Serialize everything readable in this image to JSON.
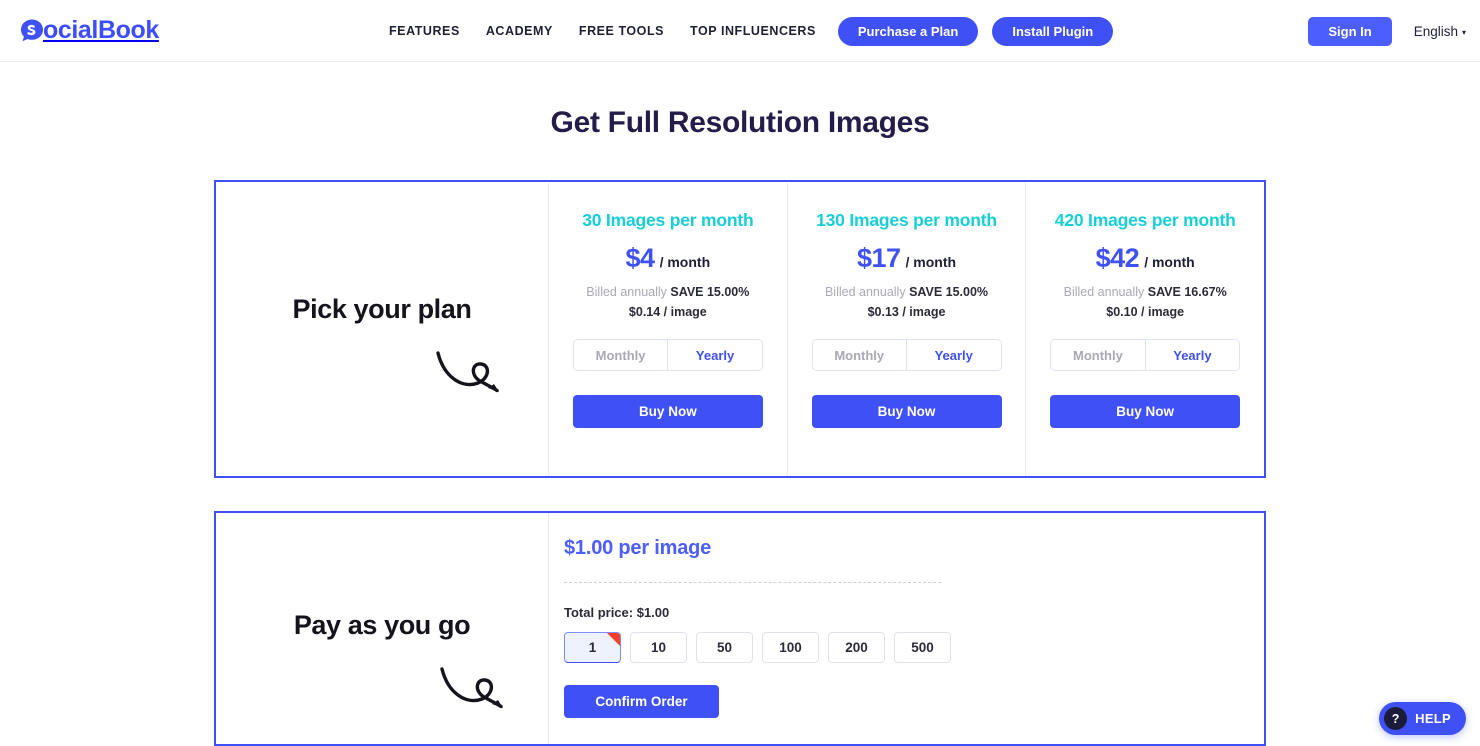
{
  "header": {
    "logo_text": "ocialBook",
    "logo_icon": "socialbook-bubble-icon",
    "nav": [
      {
        "label": "FEATURES"
      },
      {
        "label": "ACADEMY"
      },
      {
        "label": "FREE TOOLS"
      },
      {
        "label": "TOP INFLUENCERS"
      }
    ],
    "purchase_plan_label": "Purchase a Plan",
    "install_plugin_label": "Install Plugin",
    "signin_label": "Sign In",
    "language": "English",
    "language_caret": "▾"
  },
  "page_title": "Get Full Resolution Images",
  "plans_section": {
    "picker_label": "Pick your plan",
    "arrow_icon": "curly-arrow-icon",
    "plans": [
      {
        "title": "30 Images per month",
        "price": "$4",
        "per": "/ month",
        "billed_prefix": "Billed annually ",
        "billed_save": "SAVE 15.00%",
        "unit_price": "$0.14 / image",
        "toggle": {
          "monthly": "Monthly",
          "yearly": "Yearly",
          "selected": "Yearly"
        },
        "buy_label": "Buy Now"
      },
      {
        "title": "130 Images per month",
        "price": "$17",
        "per": "/ month",
        "billed_prefix": "Billed annually ",
        "billed_save": "SAVE 15.00%",
        "unit_price": "$0.13 / image",
        "toggle": {
          "monthly": "Monthly",
          "yearly": "Yearly",
          "selected": "Yearly"
        },
        "buy_label": "Buy Now"
      },
      {
        "title": "420 Images per month",
        "price": "$42",
        "per": "/ month",
        "billed_prefix": "Billed annually ",
        "billed_save": "SAVE 16.67%",
        "unit_price": "$0.10 / image",
        "toggle": {
          "monthly": "Monthly",
          "yearly": "Yearly",
          "selected": "Yearly"
        },
        "buy_label": "Buy Now"
      }
    ]
  },
  "payg_section": {
    "label": "Pay as you go",
    "arrow_icon": "curly-arrow-icon",
    "rate": "$1.00 per image",
    "total_price": "Total price: $1.00",
    "quantities": [
      "1",
      "10",
      "50",
      "100",
      "200",
      "500"
    ],
    "selected_quantity": "1",
    "confirm_label": "Confirm Order"
  },
  "help_widget": {
    "icon": "question-mark-icon",
    "icon_glyph": "?",
    "label": "HELP"
  },
  "colors": {
    "brand_blue": "#3f51f5",
    "plan_title_teal": "#17cfd6",
    "title_navy": "#251c4a",
    "selected_ribbon_red": "#f4402a"
  }
}
